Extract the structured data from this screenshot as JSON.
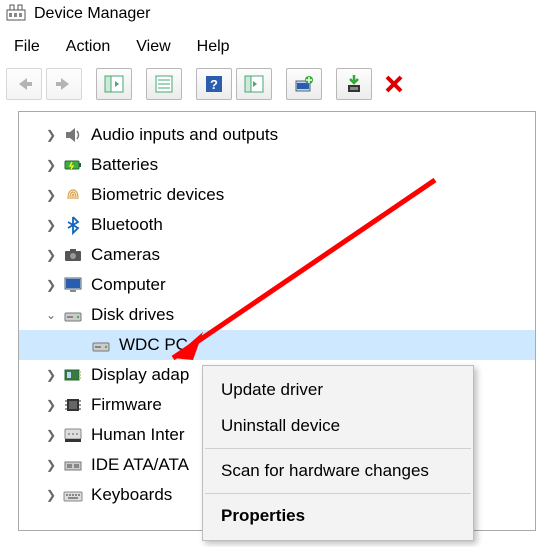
{
  "window": {
    "title": "Device Manager"
  },
  "menubar": [
    "File",
    "Action",
    "View",
    "Help"
  ],
  "tree": {
    "items": [
      {
        "label": "Audio inputs and outputs",
        "expanded": false
      },
      {
        "label": "Batteries",
        "expanded": false
      },
      {
        "label": "Biometric devices",
        "expanded": false
      },
      {
        "label": "Bluetooth",
        "expanded": false
      },
      {
        "label": "Cameras",
        "expanded": false
      },
      {
        "label": "Computer",
        "expanded": false
      },
      {
        "label": "Disk drives",
        "expanded": true,
        "children": [
          {
            "label": "WDC PC",
            "selected": true
          }
        ]
      },
      {
        "label": "Display adap",
        "expanded": false
      },
      {
        "label": "Firmware",
        "expanded": false
      },
      {
        "label": "Human Inter",
        "expanded": false
      },
      {
        "label": "IDE ATA/ATA",
        "expanded": false
      },
      {
        "label": "Keyboards",
        "expanded": false
      }
    ]
  },
  "context_menu": {
    "update": "Update driver",
    "uninstall": "Uninstall device",
    "scan": "Scan for hardware changes",
    "properties": "Properties"
  },
  "colors": {
    "selection": "#cde8ff",
    "arrow": "#ff0000"
  }
}
